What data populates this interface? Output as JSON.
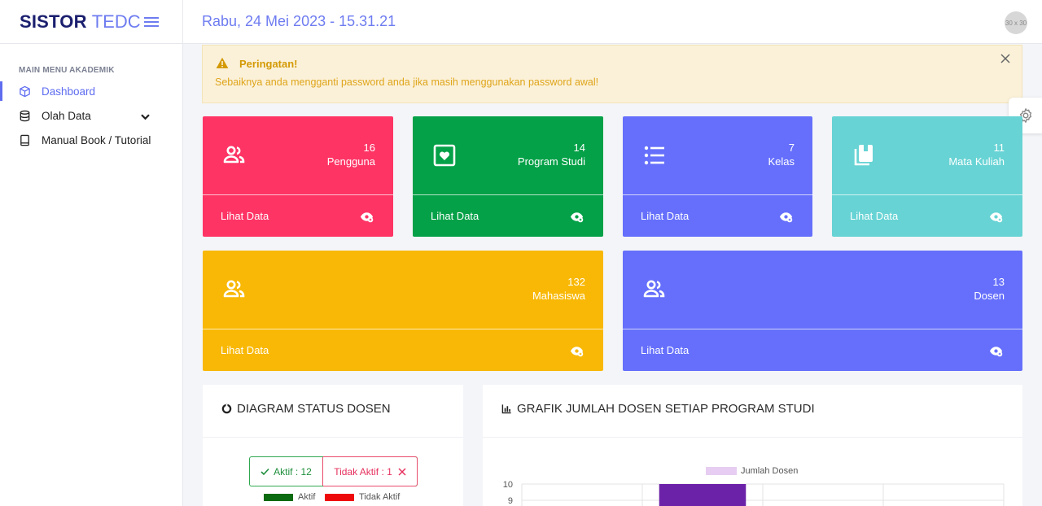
{
  "brand": {
    "strong": "SISTOR",
    "light": "TEDC"
  },
  "header": {
    "datetime": "Rabu, 24 Mei 2023 - 15.31.21",
    "avatar_text": "30 x 30"
  },
  "sidebar": {
    "section": "MAIN MENU AKADEMIK",
    "items": [
      {
        "label": "Dashboard",
        "icon": "cube-icon",
        "active": true
      },
      {
        "label": "Olah Data",
        "icon": "database-icon",
        "has_children": true
      },
      {
        "label": "Manual Book / Tutorial",
        "icon": "book-icon"
      }
    ]
  },
  "alert": {
    "title": "Peringatan!",
    "message": "Sebaiknya anda mengganti password anda jika masih menggunakan password awal!"
  },
  "cards": [
    {
      "count": "16",
      "label": "Pengguna",
      "link": "Lihat Data",
      "color": "#fe3465",
      "icon": "users-icon"
    },
    {
      "count": "14",
      "label": "Program Studi",
      "link": "Lihat Data",
      "color": "#05a148",
      "icon": "heart-square-icon"
    },
    {
      "count": "7",
      "label": "Kelas",
      "link": "Lihat Data",
      "color": "#656ffb",
      "icon": "list-icon"
    },
    {
      "count": "11",
      "label": "Mata Kuliah",
      "link": "Lihat Data",
      "color": "#67d3d4",
      "icon": "books-icon"
    },
    {
      "count": "132",
      "label": "Mahasiswa",
      "link": "Lihat Data",
      "color": "#f8b805",
      "icon": "users-icon"
    },
    {
      "count": "13",
      "label": "Dosen",
      "link": "Lihat Data",
      "color": "#656ffb",
      "icon": "users-icon"
    }
  ],
  "panels": {
    "status": {
      "title": "DIAGRAM STATUS DOSEN",
      "aktif": "Aktif : 12",
      "tidak_aktif": "Tidak Aktif : 1",
      "legend_aktif": "Aktif",
      "legend_tidak": "Tidak Aktif",
      "colors": {
        "aktif": "#0b6b11",
        "tidak": "#ee0a0a"
      }
    },
    "grafik": {
      "title": "GRAFIK JUMLAH DOSEN SETIAP PROGRAM STUDI"
    }
  },
  "chart_data": {
    "type": "bar",
    "legend": [
      "Jumlah Dosen"
    ],
    "series": [
      {
        "name": "Jumlah Dosen",
        "color": "#6b21a8",
        "legend_color": "#e6cdf1"
      }
    ],
    "ylim": [
      0,
      10
    ],
    "yticks_visible": [
      "10",
      "9"
    ],
    "visible_bar": {
      "category_index": 1,
      "value": 10
    },
    "grid": true
  }
}
